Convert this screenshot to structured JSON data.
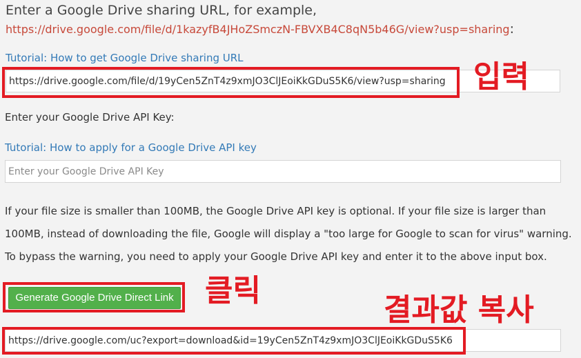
{
  "intro": {
    "text": "Enter a Google Drive sharing URL, for example, ",
    "example_url": "https://drive.google.com/file/d/1kazyfB4JHoZSmczN-FBVXB4C8qN5b46G/view?usp=sharing",
    "suffix": ":"
  },
  "sharing": {
    "tutorial_link": "Tutorial: How to get Google Drive sharing URL",
    "input_value": "https://drive.google.com/file/d/19yCen5ZnT4z9xmJO3ClJEoiKkGDuS5K6/view?usp=sharing"
  },
  "api": {
    "label": "Enter your Google Drive API Key:",
    "tutorial_link": "Tutorial: How to apply for a Google Drive API key",
    "input_placeholder": "Enter your Google Drive API Key"
  },
  "info_text": "If your file size is smaller than 100MB, the Google Drive API key is optional. If your file size is larger than 100MB, instead of downloading the file, Google will display a \"too large for Google to scan for virus\" warning. To bypass the warning, you need to apply your Google Drive API key and enter it to the above input box.",
  "generate_button": "Generate Google Drive Direct Link",
  "result": {
    "output_value": "https://drive.google.com/uc?export=download&id=19yCen5ZnT4z9xmJO3ClJEoiKkGDuS5K6"
  },
  "annotations": {
    "input": "입력",
    "click": "클릭",
    "copy_result": "결과값 복사",
    "color": "#e31b23"
  },
  "colors": {
    "background": "#f3f3f3",
    "link": "#337ab7",
    "example_url": "#c7493a",
    "button": "#52b04b"
  }
}
